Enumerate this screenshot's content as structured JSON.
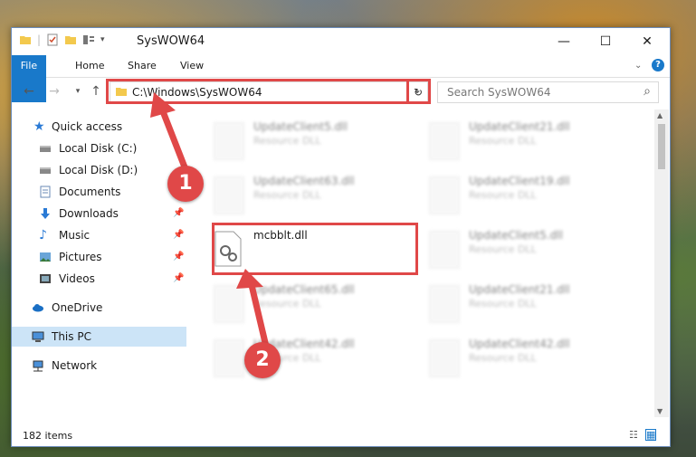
{
  "window": {
    "title": "SysWOW64",
    "controls": {
      "minimize": "—",
      "maximize": "☐",
      "close": "✕"
    }
  },
  "ribbon": {
    "tabs": [
      {
        "label": "File"
      },
      {
        "label": "Home"
      },
      {
        "label": "Share"
      },
      {
        "label": "View"
      }
    ]
  },
  "nav": {
    "back": "←",
    "forward": "→",
    "recent": "▾",
    "up": "↑",
    "address": "C:\\Windows\\SysWOW64",
    "address_dropdown": "⌄",
    "refresh": "↻",
    "search_placeholder": "Search SysWOW64",
    "search_icon": "⌕"
  },
  "sidebar": {
    "items": [
      {
        "label": "Quick access",
        "icon": "star-icon"
      },
      {
        "label": "Local Disk (C:)",
        "icon": "disk-icon"
      },
      {
        "label": "Local Disk (D:)",
        "icon": "disk-icon"
      },
      {
        "label": "Documents",
        "icon": "documents-icon"
      },
      {
        "label": "Downloads",
        "icon": "downloads-icon"
      },
      {
        "label": "Music",
        "icon": "music-icon"
      },
      {
        "label": "Pictures",
        "icon": "pictures-icon"
      },
      {
        "label": "Videos",
        "icon": "videos-icon"
      },
      {
        "label": "OneDrive",
        "icon": "cloud-icon"
      },
      {
        "label": "This PC",
        "icon": "pc-icon"
      },
      {
        "label": "Network",
        "icon": "network-icon"
      }
    ]
  },
  "files": {
    "left": [
      {
        "name": "UpdateClient5.dll",
        "type": "Resource DLL"
      },
      {
        "name": "UpdateClient63.dll",
        "type": "Resource DLL"
      },
      {
        "name": "mcbblt.dll",
        "type": ""
      },
      {
        "name": "UpdateClient65.dll",
        "type": "Resource DLL"
      },
      {
        "name": "UpdateClient42.dll",
        "type": "Resource DLL"
      }
    ],
    "right": [
      {
        "name": "UpdateClient21.dll",
        "type": "Resource DLL"
      },
      {
        "name": "UpdateClient19.dll",
        "type": "Resource DLL"
      },
      {
        "name": "UpdateClient5.dll",
        "type": "Resource DLL"
      },
      {
        "name": "UpdateClient21.dll",
        "type": "Resource DLL"
      },
      {
        "name": "UpdateClient42.dll",
        "type": "Resource DLL"
      }
    ]
  },
  "status": {
    "items_count": "182 items"
  },
  "annotations": {
    "step1": "1",
    "step2": "2",
    "highlight_color": "#e04848"
  }
}
